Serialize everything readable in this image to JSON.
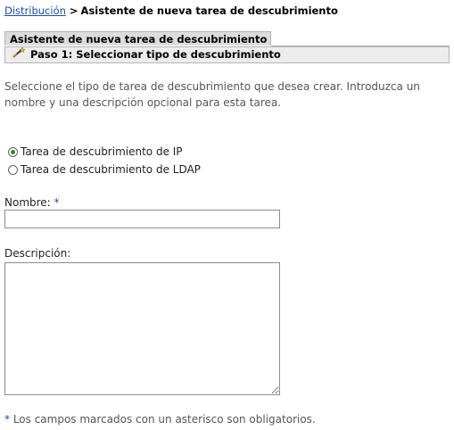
{
  "breadcrumb": {
    "parent": "Distribución",
    "separator": ">",
    "current": "Asistente de nueva tarea de descubrimiento"
  },
  "wizard": {
    "title": "Asistente de nueva tarea de descubrimiento",
    "step_label": "Paso 1: Seleccionar tipo de descubrimiento",
    "step_icon": "wand-icon"
  },
  "intro": "Seleccione el tipo de tarea de descubrimiento que desea crear. Introduzca un nombre y una descripción opcional para esta tarea.",
  "task_types": [
    {
      "label": "Tarea de descubrimiento de IP",
      "selected": true
    },
    {
      "label": "Tarea de descubrimiento de LDAP",
      "selected": false
    }
  ],
  "form": {
    "name_label": "Nombre:",
    "required_marker": "*",
    "name_value": "",
    "description_label": "Descripción:",
    "description_value": ""
  },
  "footnote": {
    "marker": "*",
    "text": " Los campos marcados con un asterisco son obligatorios."
  },
  "colors": {
    "link": "#1a4fa3",
    "header_bg": "#dcdcdc",
    "step_bg": "#ececec",
    "radio_selected": "#2a8a2a"
  }
}
